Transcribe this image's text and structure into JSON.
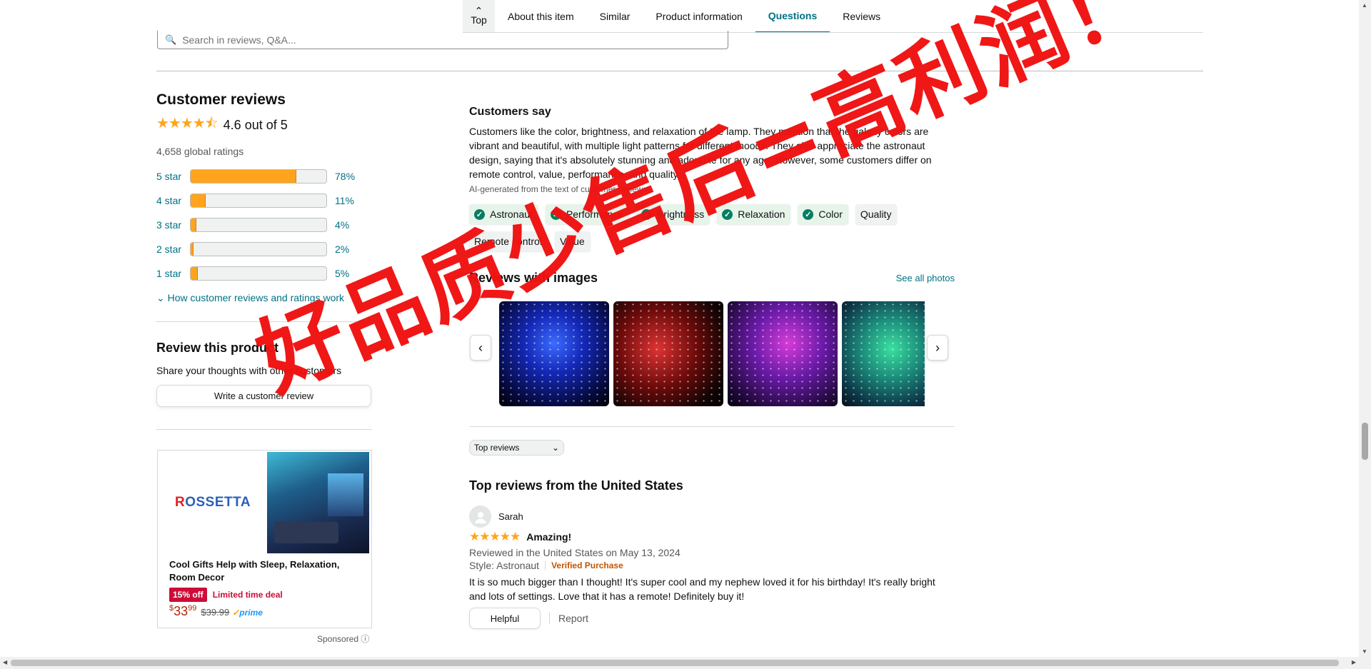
{
  "nav": {
    "top_label": "Top",
    "tabs": [
      {
        "label": "About this item"
      },
      {
        "label": "Similar"
      },
      {
        "label": "Product information"
      },
      {
        "label": "Questions",
        "active": true
      },
      {
        "label": "Reviews"
      }
    ]
  },
  "search": {
    "placeholder": "Search in reviews, Q&A..."
  },
  "reviews_summary": {
    "heading": "Customer reviews",
    "rating": 4.6,
    "rating_text": "4.6 out of 5",
    "global_ratings": "4,658 global ratings",
    "histogram": [
      {
        "label": "5 star",
        "percent_text": "78%",
        "percent": 78
      },
      {
        "label": "4 star",
        "percent_text": "11%",
        "percent": 11
      },
      {
        "label": "3 star",
        "percent_text": "4%",
        "percent": 4
      },
      {
        "label": "2 star",
        "percent_text": "2%",
        "percent": 2
      },
      {
        "label": "1 star",
        "percent_text": "5%",
        "percent": 5
      }
    ],
    "how_link": "How customer reviews and ratings work"
  },
  "review_product": {
    "heading": "Review this product",
    "subtext": "Share your thoughts with other customers",
    "button": "Write a customer review"
  },
  "ad": {
    "brand_prefix": "R",
    "brand_rest": "OSSETTA",
    "title": "Cool Gifts Help with Sleep, Relaxation, Room Decor",
    "discount": "15% off",
    "deal_label": "Limited time deal",
    "price_symbol": "$",
    "price_whole": "33",
    "price_fraction": "99",
    "list_price": "$39.99",
    "prime": "prime",
    "sponsored": "Sponsored"
  },
  "customers_say": {
    "heading": "Customers say",
    "summary": "Customers like the color, brightness, and relaxation of the lamp. They mention that the galaxy colors are vibrant and beautiful, with multiple light patterns for different moods. They also appreciate the astronaut design, saying that it's absolutely stunning and adorable for any age. However, some customers differ on remote control, value, performance, and quality.",
    "ai_note": "AI-generated from the text of customer reviews",
    "chips": [
      {
        "label": "Astronaut",
        "positive": true
      },
      {
        "label": "Performance",
        "positive": true
      },
      {
        "label": "Brightness",
        "positive": true
      },
      {
        "label": "Relaxation",
        "positive": true
      },
      {
        "label": "Color",
        "positive": true
      },
      {
        "label": "Quality",
        "positive": false
      },
      {
        "label": "Remote control",
        "positive": false
      },
      {
        "label": "Value",
        "positive": false
      }
    ]
  },
  "images": {
    "heading": "Reviews with images",
    "see_all": "See all photos"
  },
  "sort": {
    "selected": "Top reviews"
  },
  "top_reviews": {
    "heading": "Top reviews from the United States",
    "items": [
      {
        "author": "Sarah",
        "stars": 5,
        "title": "Amazing!",
        "reviewed": "Reviewed in the United States on May 13, 2024",
        "style": "Style: Astronaut",
        "verified": "Verified Purchase",
        "body": "It is so much bigger than I thought! It's super cool and my nephew loved it for his birthday! It's really bright and lots of settings. Love that it has a remote! Definitely buy it!",
        "helpful": "Helpful",
        "report": "Report"
      }
    ]
  },
  "watermark": "好品质少售后=高利润！",
  "colors": {
    "link": "#007185",
    "star": "#ffa41c",
    "deal": "#cc0c39",
    "watermark": "#f01010"
  }
}
